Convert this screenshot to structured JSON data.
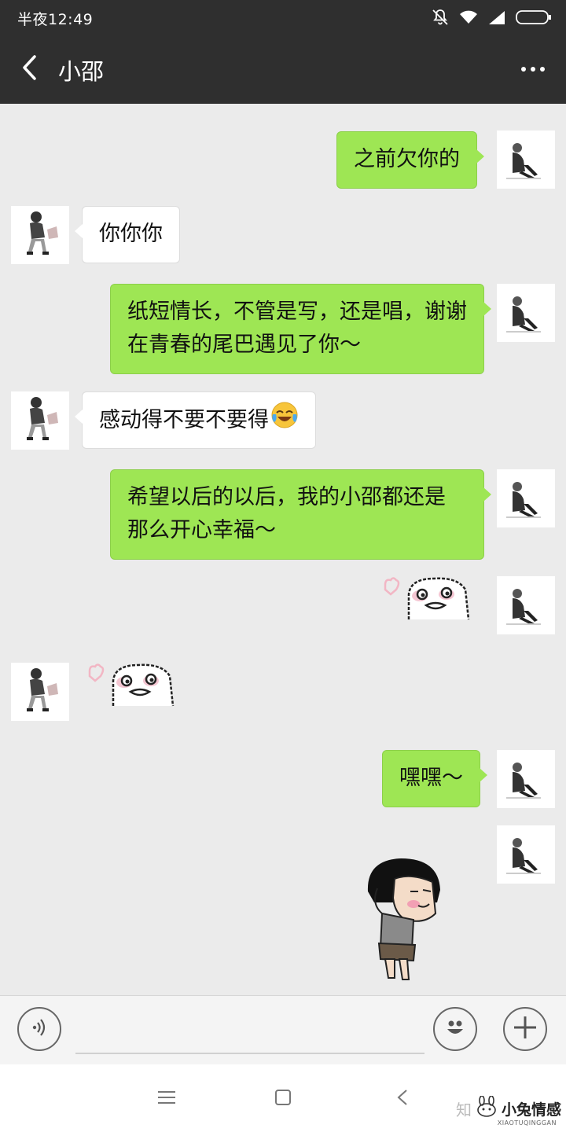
{
  "status_bar": {
    "time": "半夜12:49",
    "icons": [
      "mute-bell-icon",
      "wifi-icon",
      "signal-icon",
      "battery-icon"
    ]
  },
  "header": {
    "title": "小邵",
    "back_icon": "chevron-left-icon",
    "more_icon": "more-dots-icon"
  },
  "messages": [
    {
      "side": "out",
      "type": "text",
      "text": "之前欠你的"
    },
    {
      "side": "in",
      "type": "text",
      "text": "你你你"
    },
    {
      "side": "out",
      "type": "text",
      "line1": "纸短情长，不管是写，还是唱，谢谢",
      "line2": "在青春的尾巴遇见了你～"
    },
    {
      "side": "in",
      "type": "text",
      "text": "感动得不要不要得",
      "emoji": "tears-of-joy-emoji"
    },
    {
      "side": "out",
      "type": "text",
      "line1": "希望以后的以后，我的小邵都还是",
      "line2": "那么开心幸福～"
    },
    {
      "side": "out",
      "type": "sticker",
      "sticker": "pixel-face-heart-sticker"
    },
    {
      "side": "in",
      "type": "sticker",
      "sticker": "pixel-face-heart-sticker"
    },
    {
      "side": "out",
      "type": "text",
      "text": "嘿嘿～"
    },
    {
      "side": "out",
      "type": "sticker",
      "sticker": "cartoon-boy-sticker"
    }
  ],
  "input_bar": {
    "voice_icon": "voice-icon",
    "emoji_icon": "emoji-icon",
    "plus_icon": "plus-icon",
    "value": ""
  },
  "nav_bar": {
    "icons": [
      "menu-icon",
      "home-square-icon",
      "back-triangle-icon"
    ]
  },
  "watermark": {
    "zhi": "知",
    "name": "小兔情感",
    "sub": "XIAOTUQINGGAN"
  },
  "colors": {
    "bar": "#2f2f2f",
    "chat_bg": "#ebebeb",
    "outgoing_bubble": "#9ee654",
    "incoming_bubble": "#ffffff"
  }
}
